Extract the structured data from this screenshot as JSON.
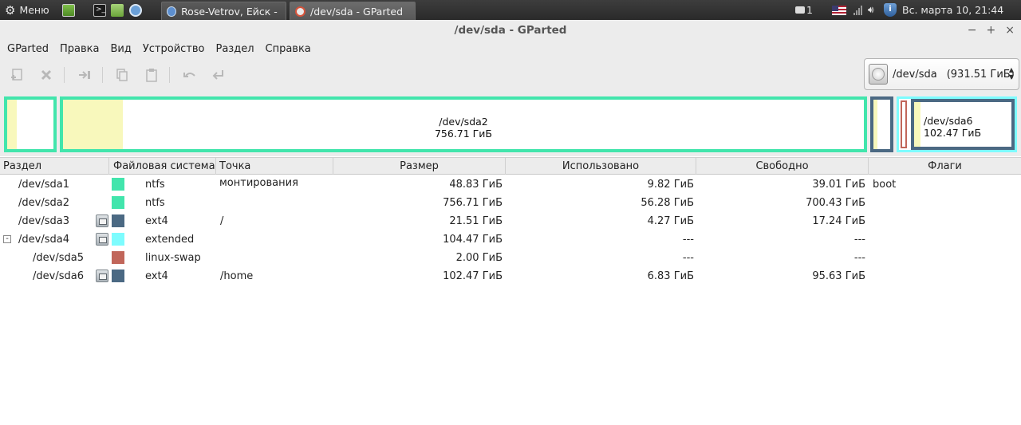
{
  "panel": {
    "menu_label": "Меню",
    "tasks": [
      {
        "label": "Rose-Vetrov, Ейск - ..."
      },
      {
        "label": "/dev/sda - GParted"
      }
    ],
    "mail_count": "1",
    "clock": "Вс. марта 10, 21:44"
  },
  "window": {
    "title": "/dev/sda - GParted"
  },
  "menu": [
    "GParted",
    "Правка",
    "Вид",
    "Устройство",
    "Раздел",
    "Справка"
  ],
  "device_selector": {
    "device": "/dev/sda",
    "size": "(931.51 ГиБ)"
  },
  "graphic": {
    "sda2_name": "/dev/sda2",
    "sda2_size": "756.71 ГиБ",
    "sda6_name": "/dev/sda6",
    "sda6_size": "102.47 ГиБ"
  },
  "columns": [
    "Раздел",
    "Файловая система",
    "Точка монтирования",
    "Размер",
    "Использовано",
    "Свободно",
    "Флаги"
  ],
  "colors": {
    "ntfs": "#42e5ac",
    "ext4": "#4b6983",
    "extended": "#7dfcfe",
    "linux-swap": "#c1665a",
    "used": "#f8f8bc"
  },
  "partitions": [
    {
      "name": "/dev/sda1",
      "locked": false,
      "fs": "ntfs",
      "color": "#42e5ac",
      "mount": "",
      "size": "48.83 ГиБ",
      "used": "9.82 ГиБ",
      "free": "39.01 ГиБ",
      "flags": "boot",
      "indent": 0
    },
    {
      "name": "/dev/sda2",
      "locked": false,
      "fs": "ntfs",
      "color": "#42e5ac",
      "mount": "",
      "size": "756.71 ГиБ",
      "used": "56.28 ГиБ",
      "free": "700.43 ГиБ",
      "flags": "",
      "indent": 0
    },
    {
      "name": "/dev/sda3",
      "locked": true,
      "fs": "ext4",
      "color": "#4b6983",
      "mount": "/",
      "size": "21.51 ГиБ",
      "used": "4.27 ГиБ",
      "free": "17.24 ГиБ",
      "flags": "",
      "indent": 0
    },
    {
      "name": "/dev/sda4",
      "locked": true,
      "fs": "extended",
      "color": "#7dfcfe",
      "mount": "",
      "size": "104.47 ГиБ",
      "used": "---",
      "free": "---",
      "flags": "",
      "indent": 0,
      "expanded": "-"
    },
    {
      "name": "/dev/sda5",
      "locked": false,
      "fs": "linux-swap",
      "color": "#c1665a",
      "mount": "",
      "size": "2.00 ГиБ",
      "used": "---",
      "free": "---",
      "flags": "",
      "indent": 1
    },
    {
      "name": "/dev/sda6",
      "locked": true,
      "fs": "ext4",
      "color": "#4b6983",
      "mount": "/home",
      "size": "102.47 ГиБ",
      "used": "6.83 ГиБ",
      "free": "95.63 ГиБ",
      "flags": "",
      "indent": 1
    }
  ]
}
